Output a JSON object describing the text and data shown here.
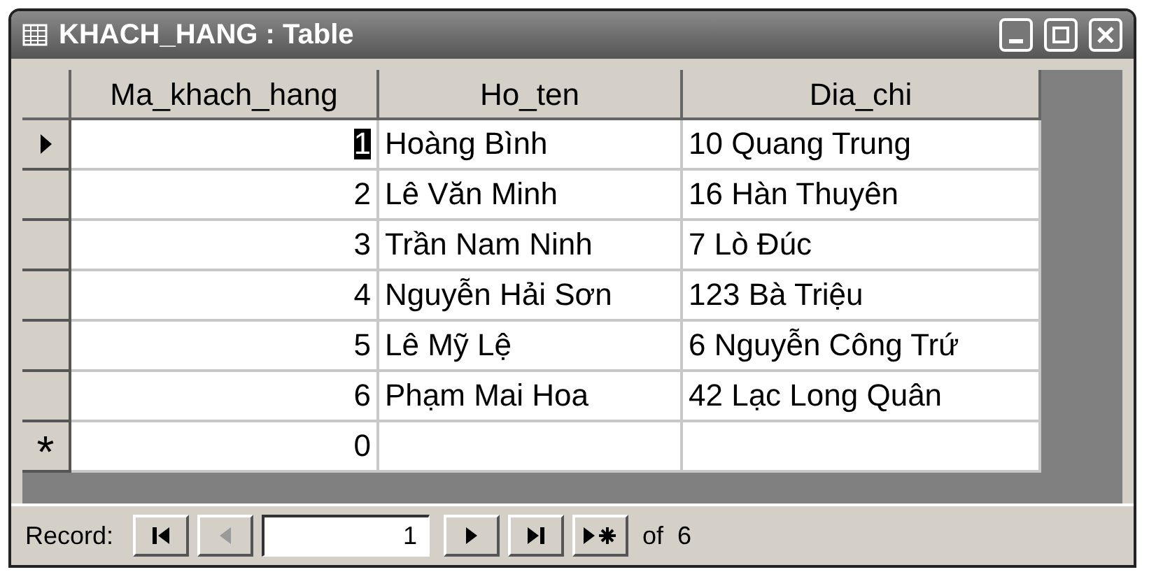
{
  "window": {
    "title": "KHACH_HANG : Table"
  },
  "table": {
    "columns": [
      "Ma_khach_hang",
      "Ho_ten",
      "Dia_chi"
    ],
    "rows": [
      {
        "ma": "1",
        "ho_ten": "Hoàng Bình",
        "dia_chi": "10 Quang Trung",
        "selected": true
      },
      {
        "ma": "2",
        "ho_ten": "Lê Văn Minh",
        "dia_chi": "16 Hàn Thuyên",
        "selected": false
      },
      {
        "ma": "3",
        "ho_ten": "Trần Nam Ninh",
        "dia_chi": "7 Lò Đúc",
        "selected": false
      },
      {
        "ma": "4",
        "ho_ten": "Nguyễn Hải Sơn",
        "dia_chi": "123 Bà Triệu",
        "selected": false
      },
      {
        "ma": "5",
        "ho_ten": "Lê Mỹ Lệ",
        "dia_chi": "6 Nguyễn Công Trứ",
        "selected": false
      },
      {
        "ma": "6",
        "ho_ten": "Phạm Mai Hoa",
        "dia_chi": "42 Lạc Long Quân",
        "selected": false
      }
    ],
    "new_row": {
      "marker": "*",
      "ma": "0"
    }
  },
  "navigator": {
    "label": "Record:",
    "buttons": [
      {
        "kind": "first",
        "disabled": false
      },
      {
        "kind": "prev",
        "disabled": true
      },
      {
        "kind": "next",
        "disabled": false
      },
      {
        "kind": "last",
        "disabled": false
      },
      {
        "kind": "new",
        "disabled": false
      }
    ],
    "current": "1",
    "total": "of  6"
  }
}
